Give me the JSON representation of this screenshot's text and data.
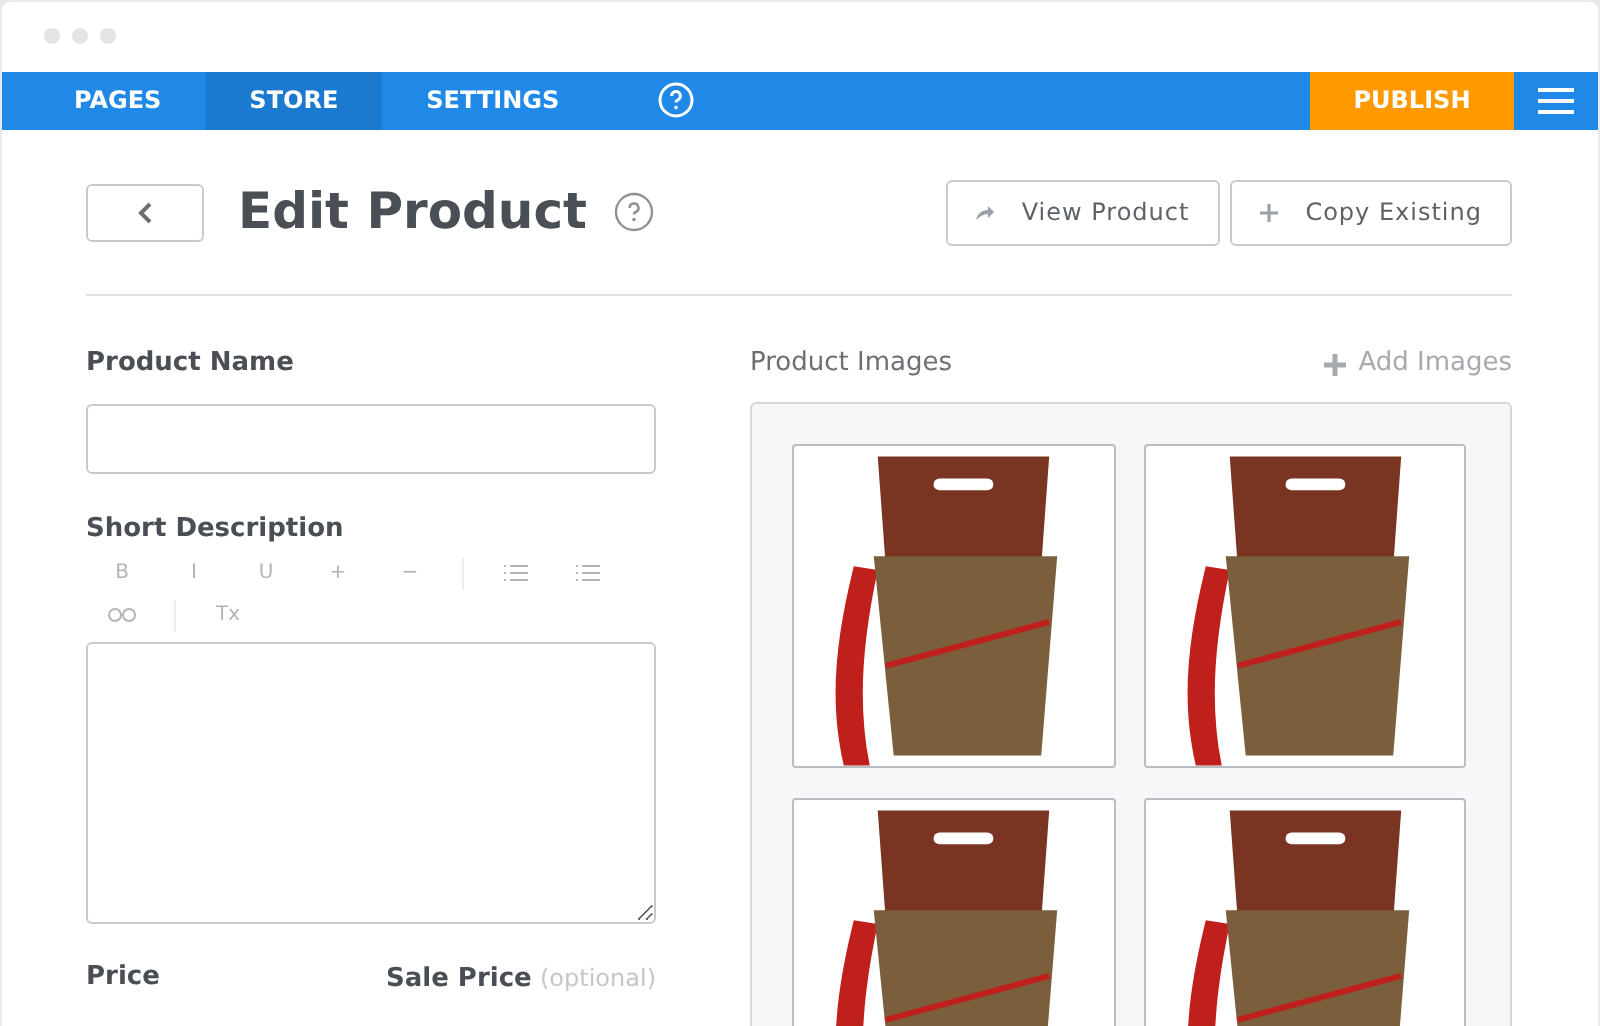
{
  "nav": {
    "tabs": [
      {
        "label": "PAGES",
        "selected": false
      },
      {
        "label": "STORE",
        "selected": true
      },
      {
        "label": "SETTINGS",
        "selected": false
      }
    ],
    "publish": "PUBLISH"
  },
  "header": {
    "title": "Edit Product",
    "buttons": [
      {
        "kind": "view",
        "label": "View Product"
      },
      {
        "kind": "copy",
        "label": "Copy Existing"
      }
    ]
  },
  "form": {
    "product_name": {
      "label": "Product Name"
    },
    "short_description": {
      "label": "Short Description",
      "toolbar": [
        [
          {
            "kind": "text",
            "label": "B"
          },
          {
            "kind": "text",
            "label": "I"
          },
          {
            "kind": "text",
            "label": "U"
          },
          {
            "kind": "text",
            "label": "+"
          },
          {
            "kind": "text",
            "label": "−"
          },
          {
            "kind": "sep"
          },
          {
            "kind": "ordered-list"
          },
          {
            "kind": "bullet-list"
          }
        ],
        [
          {
            "kind": "link"
          },
          {
            "kind": "sep"
          },
          {
            "kind": "text",
            "label": "Tx"
          }
        ]
      ]
    },
    "price": {
      "label": "Price"
    },
    "sale_price": {
      "label": "Sale Price",
      "note": "(optional)"
    }
  },
  "images": {
    "label": "Product Images",
    "add": "Add Images",
    "photos": [
      {
        "kind": "photo"
      },
      {
        "kind": "photo"
      },
      {
        "kind": "photo"
      },
      {
        "kind": "photo"
      }
    ]
  }
}
